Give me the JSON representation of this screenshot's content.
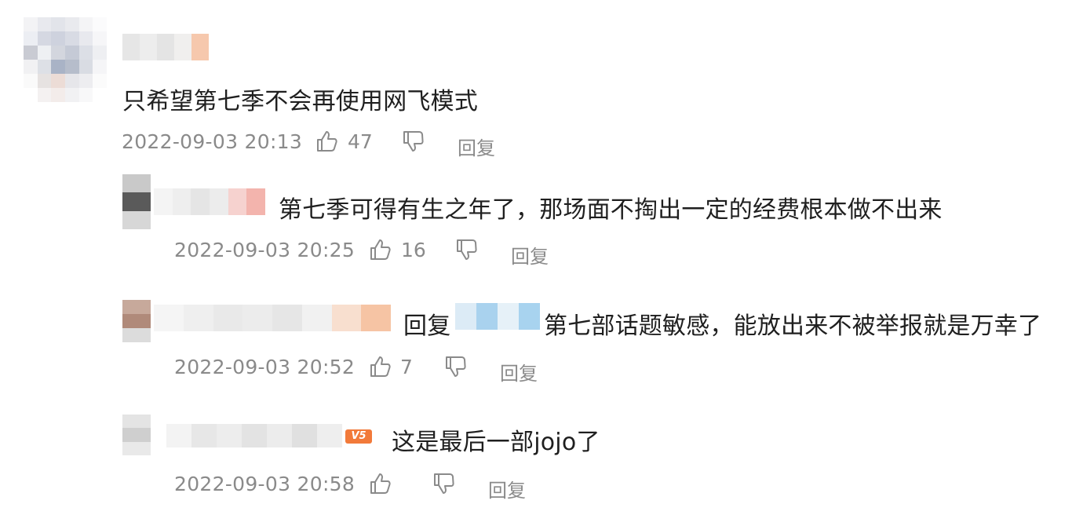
{
  "comments": [
    {
      "content": "只希望第七季不会再使用网飞模式",
      "time": "2022-09-03 20:13",
      "likes": "47",
      "reply_label": "回复"
    }
  ],
  "replies": [
    {
      "content": "第七季可得有生之年了，那场面不掏出一定的经费根本做不出来",
      "time": "2022-09-03 20:25",
      "likes": "16",
      "reply_label": "回复"
    },
    {
      "reply_prefix": "回复",
      "content": "第七部话题敏感，能放出来不被举报就是万幸了",
      "time": "2022-09-03 20:52",
      "likes": "7",
      "reply_label": "回复"
    },
    {
      "content": "这是最后一部jojo了",
      "time": "2022-09-03 20:58",
      "likes": "",
      "reply_label": "回复"
    }
  ],
  "icons": {
    "like": "thumbs-up-icon",
    "dislike": "thumbs-down-icon"
  },
  "colors": {
    "text": "#1f1f1f",
    "meta": "#8a8a8a",
    "vip_badge": "#f27a3a"
  }
}
